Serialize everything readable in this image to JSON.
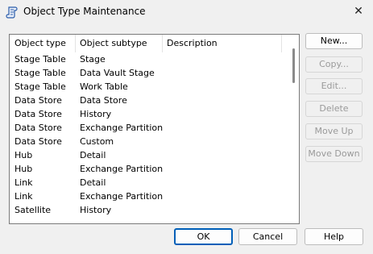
{
  "window": {
    "title": "Object Type Maintenance"
  },
  "table": {
    "columns": [
      "Object type",
      "Object subtype",
      "Description"
    ],
    "rows": [
      [
        "Stage Table",
        "Stage",
        ""
      ],
      [
        "Stage Table",
        "Data Vault Stage",
        ""
      ],
      [
        "Stage Table",
        "Work Table",
        ""
      ],
      [
        "Data Store",
        "Data Store",
        ""
      ],
      [
        "Data Store",
        "History",
        ""
      ],
      [
        "Data Store",
        "Exchange Partition",
        ""
      ],
      [
        "Data Store",
        "Custom",
        ""
      ],
      [
        "Hub",
        "Detail",
        ""
      ],
      [
        "Hub",
        "Exchange Partition",
        ""
      ],
      [
        "Link",
        "Detail",
        ""
      ],
      [
        "Link",
        "Exchange Partition",
        ""
      ],
      [
        "Satellite",
        "History",
        ""
      ]
    ]
  },
  "side_buttons": [
    {
      "label": "New...",
      "enabled": true
    },
    {
      "label": "Copy...",
      "enabled": false
    },
    {
      "label": "Edit...",
      "enabled": false
    },
    {
      "label": "Delete",
      "enabled": false
    },
    {
      "label": "Move Up",
      "enabled": false
    },
    {
      "label": "Move Down",
      "enabled": false
    }
  ],
  "bottom_buttons": {
    "ok": "OK",
    "cancel": "Cancel",
    "help": "Help"
  },
  "icons": {
    "app": "scroll-app-icon",
    "close": "close-icon"
  }
}
